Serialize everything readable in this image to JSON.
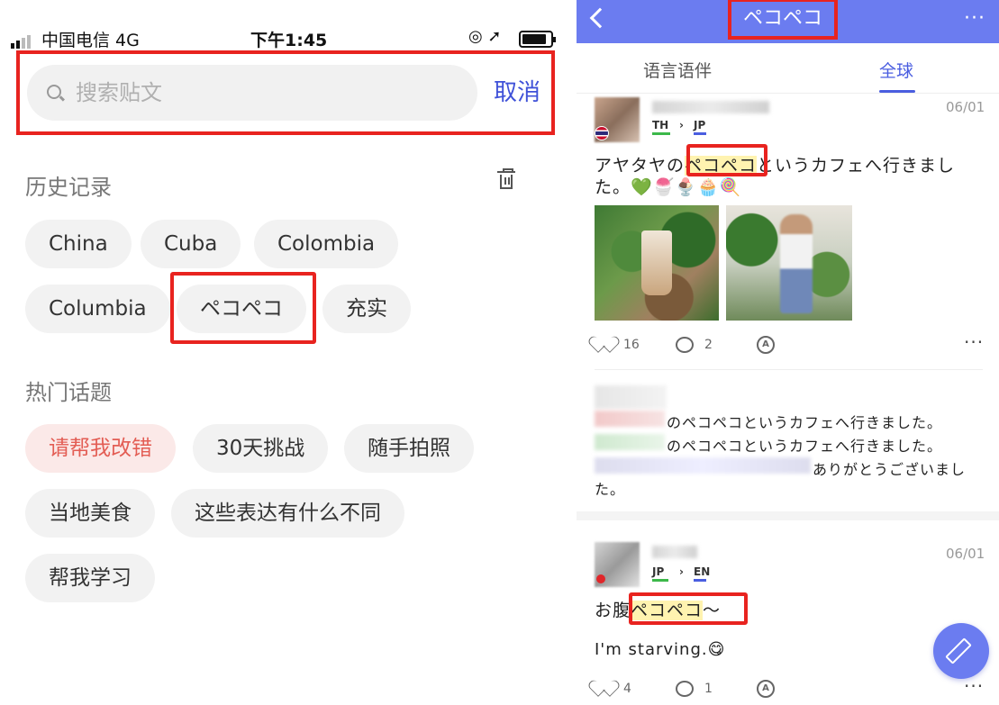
{
  "left": {
    "status": {
      "carrier": "中国电信  4G",
      "time": "下午1:45"
    },
    "search": {
      "placeholder": "搜索贴文",
      "cancel": "取消"
    },
    "history": {
      "title": "历史记录",
      "chips": [
        "China",
        "Cuba",
        "Colombia",
        "Columbia",
        "ペコペコ",
        "充实"
      ]
    },
    "hot": {
      "title": "热门话题",
      "chips": [
        "请帮我改错",
        "30天挑战",
        "随手拍照",
        "当地美食",
        "这些表达有什么不同",
        "帮我学习"
      ]
    }
  },
  "right": {
    "nav": {
      "title": "ペコペコ",
      "more": "···"
    },
    "tabs": [
      "语言语伴",
      "全球"
    ],
    "post1": {
      "lang_from": "TH",
      "lang_to": "JP",
      "date": "06/01",
      "text_before": "アヤタヤの",
      "text_hl": "ペコペコ",
      "text_after": "というカフェへ行きまし",
      "text_line2": "た。💚🍧🍨🧁🍭",
      "likes": "16",
      "comments": "2"
    },
    "reply": {
      "line1": "のペコペコというカフェへ行きました。",
      "line2": "のペコペコというカフェへ行きました。",
      "line3": "ありがとうございまし",
      "line4": "た。"
    },
    "post2": {
      "lang_from": "JP",
      "lang_to": "EN",
      "date": "06/01",
      "text_before": "お腹",
      "text_hl": "ペコペコ",
      "text_after": "～",
      "translation": "I'm starving.😋",
      "likes": "4",
      "comments": "1"
    }
  }
}
